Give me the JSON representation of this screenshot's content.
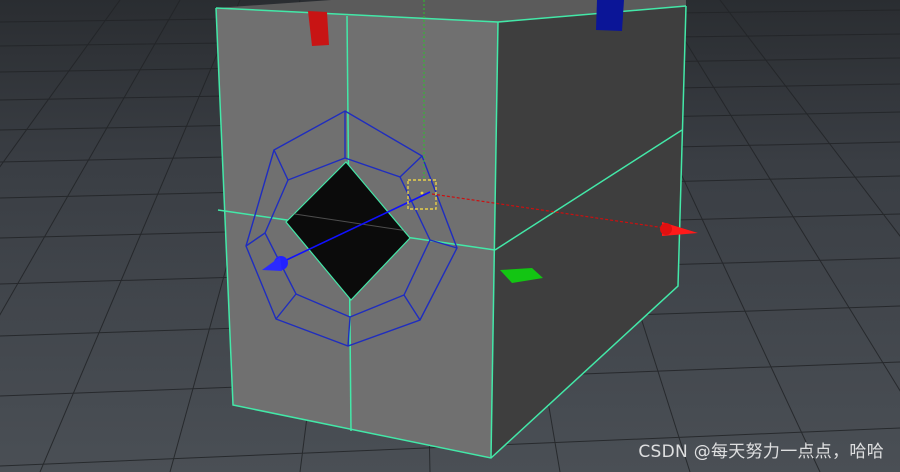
{
  "viewport": {
    "background_color": "#3a3e44",
    "grid_color": "#222427",
    "mesh_face_front": "#707070",
    "mesh_face_side": "#3e3e3e",
    "mesh_edge_color": "#43e8a8",
    "hole_color": "#0b0b0b",
    "wire_color": "#1f2dbf",
    "manipulator": {
      "x_axis_color": "#ff1010",
      "y_axis_color": "#10d010",
      "z_axis_color": "#1010ff",
      "pivot_color": "#e8d04a",
      "icons": [
        "axis-x-handle-icon",
        "axis-y-handle-icon",
        "axis-z-handle-icon",
        "pivot-box-icon"
      ]
    }
  },
  "watermark": {
    "text": "CSDN @每天努力一点点，哈哈"
  }
}
